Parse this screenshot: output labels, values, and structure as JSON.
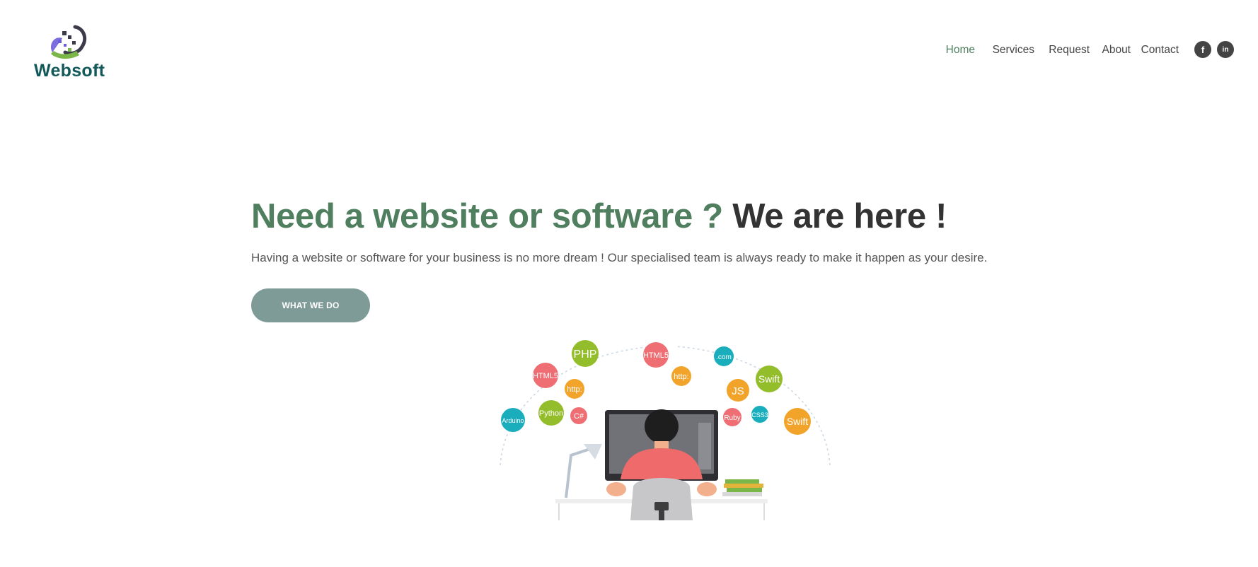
{
  "brand": {
    "name": "Websoft"
  },
  "nav": {
    "items": [
      {
        "label": "Home",
        "active": true
      },
      {
        "label": "Services",
        "active": false
      },
      {
        "label": "Request",
        "active": false
      },
      {
        "label": "About",
        "active": false
      },
      {
        "label": "Contact",
        "active": false
      }
    ],
    "social": [
      {
        "name": "facebook-icon",
        "glyph": "f"
      },
      {
        "name": "linkedin-icon",
        "glyph": "in"
      }
    ]
  },
  "hero": {
    "headline_green": "Need a website or software ?",
    "headline_dark": "We are here !",
    "subtext": "Having a website or software for your business is no more dream ! Our specialised team is always ready to make it happen as your desire.",
    "cta_label": "WHAT WE DO"
  },
  "illustration": {
    "bubbles": [
      "PHP",
      "HTML5",
      "HTML5",
      "http:",
      "http:",
      ".com",
      "Swift",
      "JS",
      "Python",
      "C#",
      "Arduino",
      "Ruby",
      "CSS3",
      "Swift"
    ]
  },
  "colors": {
    "accent_green": "#4f7f5f",
    "heading_dark": "#333333",
    "button_bg": "#7f9b98",
    "logo_text": "#13595a"
  }
}
